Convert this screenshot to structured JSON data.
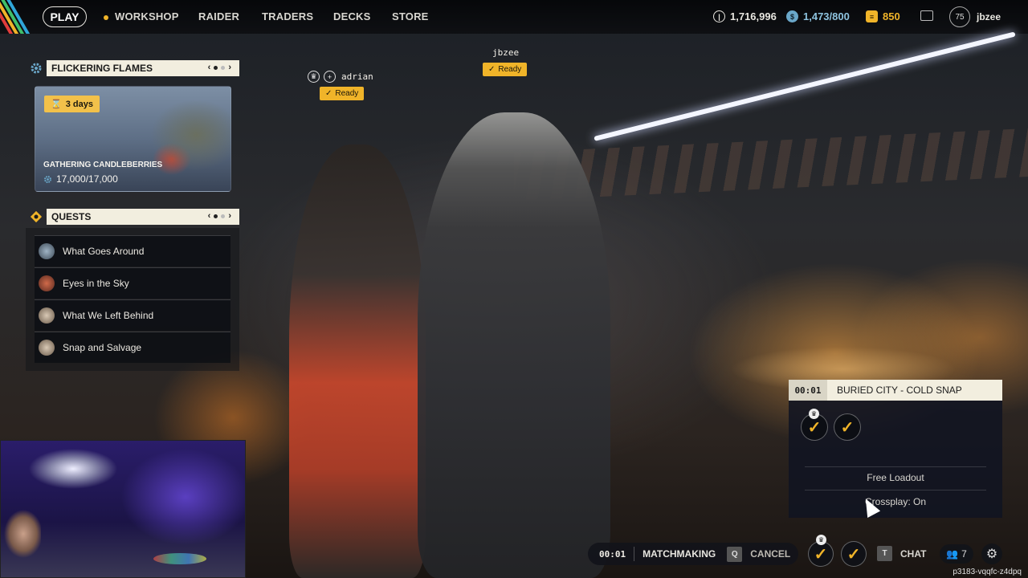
{
  "topbar": {
    "play": "PLAY",
    "nav": [
      "WORKSHOP",
      "RAIDER",
      "TRADERS",
      "DECKS",
      "STORE"
    ],
    "currencies": {
      "coins": "1,716,996",
      "tokens": "1,473/800",
      "credits": "850"
    },
    "level": "75",
    "username": "jbzee"
  },
  "event": {
    "title": "FLICKERING FLAMES",
    "days_badge": "3 days",
    "name": "GATHERING CANDLEBERRIES",
    "progress": "17,000/17,000"
  },
  "quests": {
    "title": "QUESTS",
    "items": [
      {
        "label": "What Goes Around"
      },
      {
        "label": "Eyes in the Sky"
      },
      {
        "label": "What We Left Behind"
      },
      {
        "label": "Snap and Salvage"
      }
    ]
  },
  "lobby": {
    "players": [
      {
        "name": "adrian",
        "status": "Ready"
      },
      {
        "name": "jbzee",
        "status": "Ready"
      }
    ]
  },
  "match": {
    "timer": "00:01",
    "map": "BURIED CITY - COLD SNAP",
    "loadout": "Free Loadout",
    "crossplay": "Crossplay: On"
  },
  "bottombar": {
    "timer": "00:01",
    "matchmaking": "MATCHMAKING",
    "cancel_key": "Q",
    "cancel": "CANCEL",
    "chat_key": "T",
    "chat": "CHAT",
    "friends_count": "7"
  },
  "session_id": "p3183-vqqfc-z4dpq",
  "colors": {
    "accent": "#f0b429",
    "panel_title_bg": "#f2eedf",
    "topbar_bg": "#0a0b0e"
  },
  "icons": [
    "gear-icon",
    "hourglass-icon",
    "quest-diamond-icon",
    "crown-icon",
    "check-icon",
    "coin-icon",
    "token-icon",
    "credits-icon",
    "mail-icon",
    "friends-icon",
    "settings-icon",
    "cursor-icon"
  ]
}
